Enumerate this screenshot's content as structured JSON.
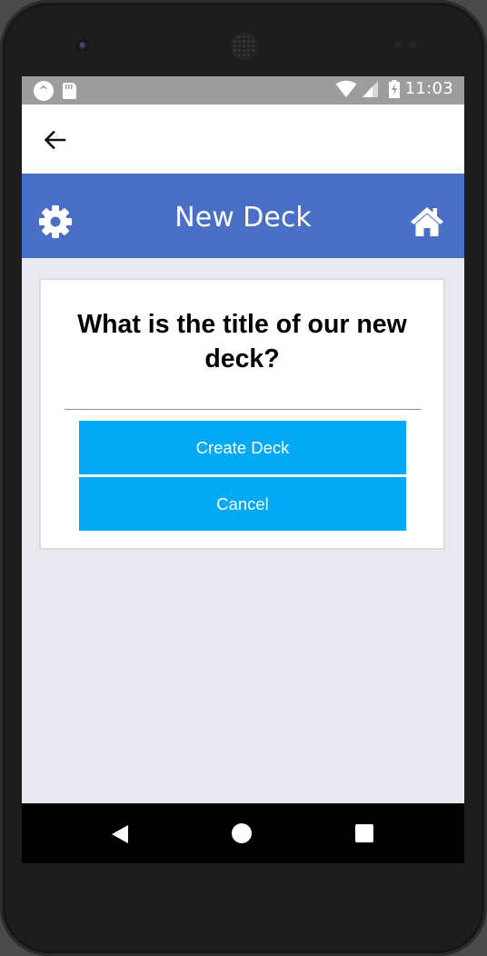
{
  "status_bar": {
    "time": "11:03",
    "left_icons": [
      "expo-icon",
      "sd-card-icon"
    ],
    "right_icons": [
      "wifi-icon",
      "cell-signal-icon",
      "battery-charging-icon"
    ],
    "expo_glyph": "^"
  },
  "nav": {
    "back_icon": "arrow-left-icon"
  },
  "header": {
    "title": "New Deck",
    "left_icon": "gear-icon",
    "right_icon": "home-icon",
    "background_color": "#4a6fc6"
  },
  "card": {
    "question": "What is the title of our new deck?",
    "input": {
      "value": "",
      "placeholder": ""
    },
    "create_button_label": "Create Deck",
    "cancel_button_label": "Cancel",
    "button_color": "#03a9f4"
  },
  "system_nav": {
    "icons": [
      "back-triangle-icon",
      "home-circle-icon",
      "recents-square-icon"
    ]
  }
}
